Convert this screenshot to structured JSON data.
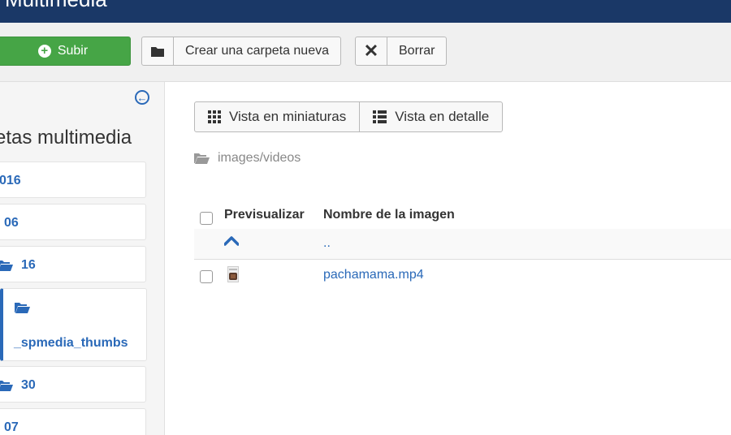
{
  "window": {
    "title": "Multimedia"
  },
  "toolbar": {
    "upload_label": "Subir",
    "new_folder_label": "Crear una carpeta nueva",
    "delete_label": "Borrar"
  },
  "sidebar": {
    "title": "etas multimedia",
    "items": [
      {
        "label": "016"
      },
      {
        "label": "06"
      },
      {
        "label": "16"
      },
      {
        "label": "_spmedia_thumbs"
      },
      {
        "label": "30"
      },
      {
        "label": "07"
      }
    ]
  },
  "main": {
    "view_thumbnails_label": "Vista en miniaturas",
    "view_detail_label": "Vista en detalle",
    "path": "images/videos",
    "columns": {
      "preview": "Previsualizar",
      "name": "Nombre de la imagen"
    },
    "rows": [
      {
        "name": ".."
      },
      {
        "name": "pachamama.mp4"
      }
    ]
  },
  "colors": {
    "header": "#1a3867",
    "upload_button": "#46a546",
    "link": "#2a69b8"
  },
  "icons": [
    "plus-circle-icon",
    "folder-icon",
    "close-icon",
    "arrow-left-circle-icon",
    "folder-open-icon",
    "grid-icon",
    "list-icon",
    "chevron-up-icon",
    "video-file-icon"
  ]
}
